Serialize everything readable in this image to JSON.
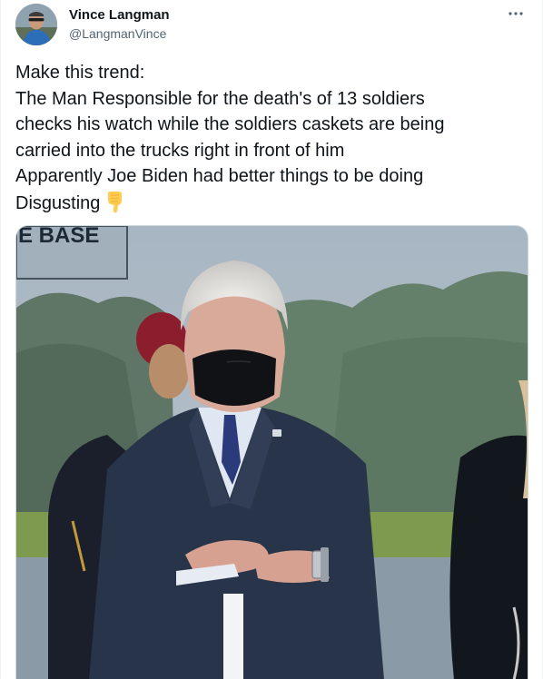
{
  "author": {
    "display_name": "Vince Langman",
    "handle": "@LangmanVince"
  },
  "more_icon": "more-horizontal-icon",
  "tweet": {
    "lines": [
      "Make this trend:",
      "The Man Responsible for the death's of 13 soldiers",
      "checks his watch while the soldiers caskets are being",
      "carried into the trucks right in front of him",
      "Apparently Joe Biden had better things to be doing",
      "Disgusting"
    ],
    "emoji": "backhand-index-pointing-down-emoji"
  },
  "media": {
    "sign_text": "E BASE"
  },
  "colors": {
    "text": "#0f1419",
    "secondary": "#536471",
    "border": "#cfd9de"
  }
}
